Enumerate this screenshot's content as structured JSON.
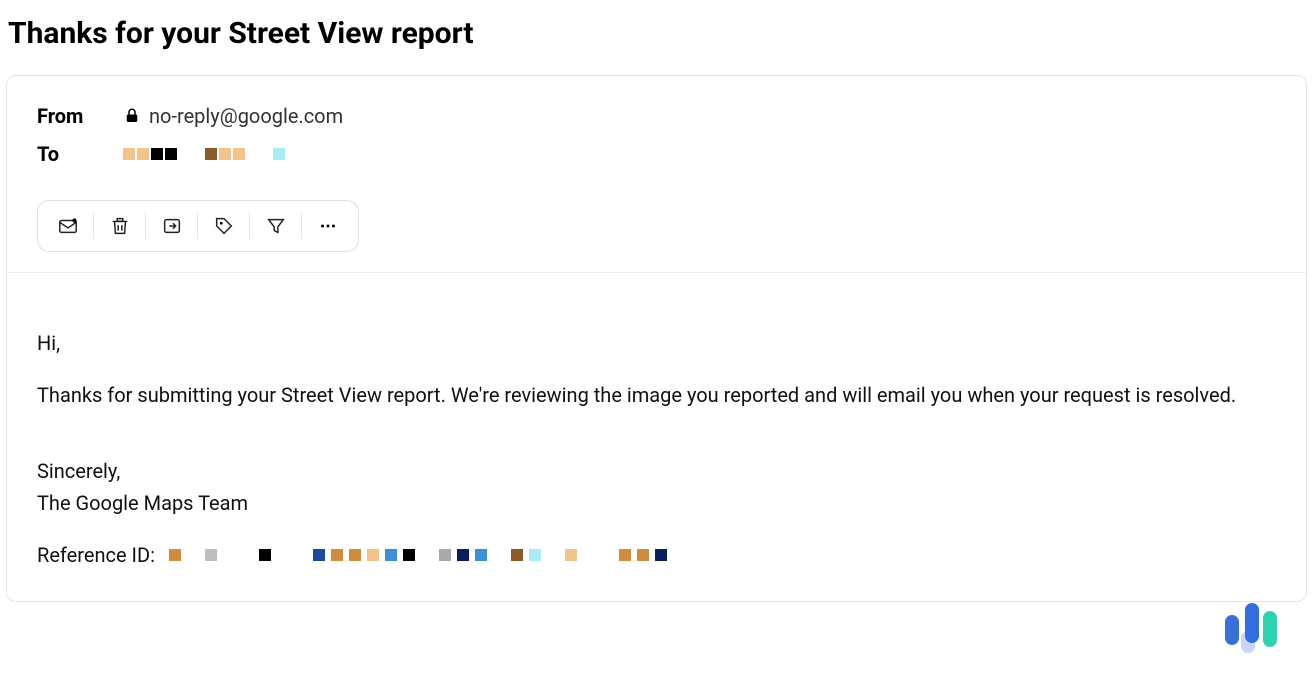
{
  "title": "Thanks for your Street View report",
  "header": {
    "from_label": "From",
    "from_value": "no-reply@google.com",
    "to_label": "To",
    "to_redaction_colors_group1": [
      "#f2c48a",
      "#f2c48a",
      "#000000",
      "#000000"
    ],
    "to_redaction_colors_group2": [
      "#8b5a2b",
      "#f2c48a",
      "#f2c48a"
    ],
    "to_redaction_colors_group3": [
      "#a7ecf2"
    ]
  },
  "toolbar": {
    "mark_unread": "mark-unread-icon",
    "delete": "trash-icon",
    "move": "move-to-icon",
    "tag": "tag-icon",
    "filter": "filter-icon",
    "more": "more-icon"
  },
  "body": {
    "greeting": "Hi,",
    "p1": "Thanks for submitting your Street View report. We're reviewing the image you reported and will email you when your request is resolved.",
    "sig1": "Sincerely,",
    "sig2": "The Google Maps Team",
    "ref_label": "Reference ID:",
    "ref_redaction_groups": [
      [
        "#d18b3a",
        "#ffffff",
        "#bdbdbd",
        "#ffffff",
        "#ffffff",
        "#000000"
      ],
      [
        "#1c4aa0",
        "#d18b3a",
        "#d18b3a",
        "#f2c48a",
        "#3a8fd6",
        "#000000",
        "#ffffff",
        "#a9a9a9",
        "#0b1e5c",
        "#3a8fd6",
        "#ffffff",
        "#8b5a2b",
        "#a7ecf2",
        "#ffffff",
        "#f2c48a"
      ],
      [
        "#d18b3a",
        "#d18b3a",
        "#0b1e5c"
      ]
    ]
  }
}
